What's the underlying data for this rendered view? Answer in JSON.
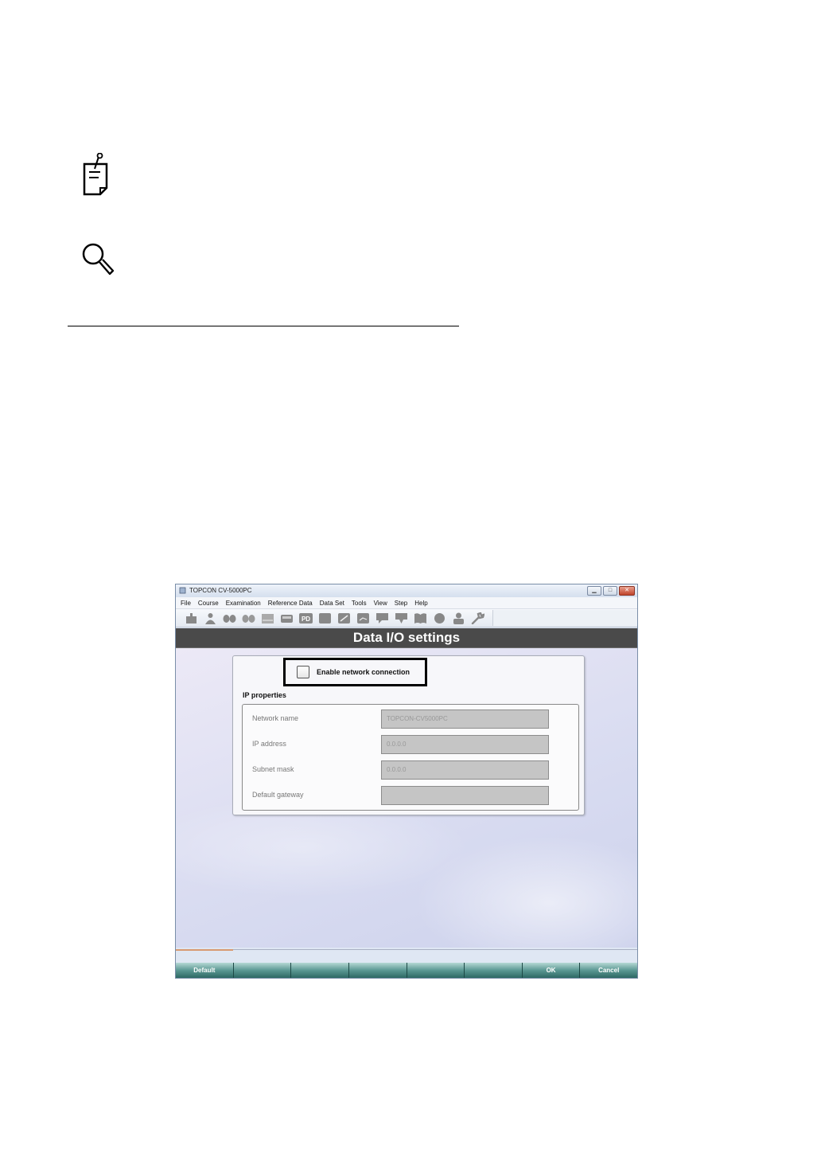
{
  "page": {
    "icons": [
      "note-icon",
      "magnifier-icon"
    ]
  },
  "window": {
    "title": "TOPCON CV-5000PC",
    "controls": [
      "minimize",
      "maximize",
      "close"
    ]
  },
  "menu": [
    "File",
    "Course",
    "Examination",
    "Reference Data",
    "Data Set",
    "Tools",
    "View",
    "Step",
    "Help"
  ],
  "toolbar": {
    "pd_label": "PD"
  },
  "header": {
    "title": "Data I/O settings"
  },
  "settings": {
    "enable_label": "Enable network connection",
    "enable_checked": false,
    "ip_title": "IP properties",
    "fields": [
      {
        "label": "Network name",
        "value": "TOPCON-CV5000PC"
      },
      {
        "label": "IP address",
        "value": "0.0.0.0"
      },
      {
        "label": "Subnet mask",
        "value": "0.0.0.0"
      },
      {
        "label": "Default gateway",
        "value": ""
      }
    ]
  },
  "footer": {
    "buttons": [
      "Default",
      "",
      "",
      "",
      "",
      "",
      "OK",
      "Cancel"
    ]
  }
}
